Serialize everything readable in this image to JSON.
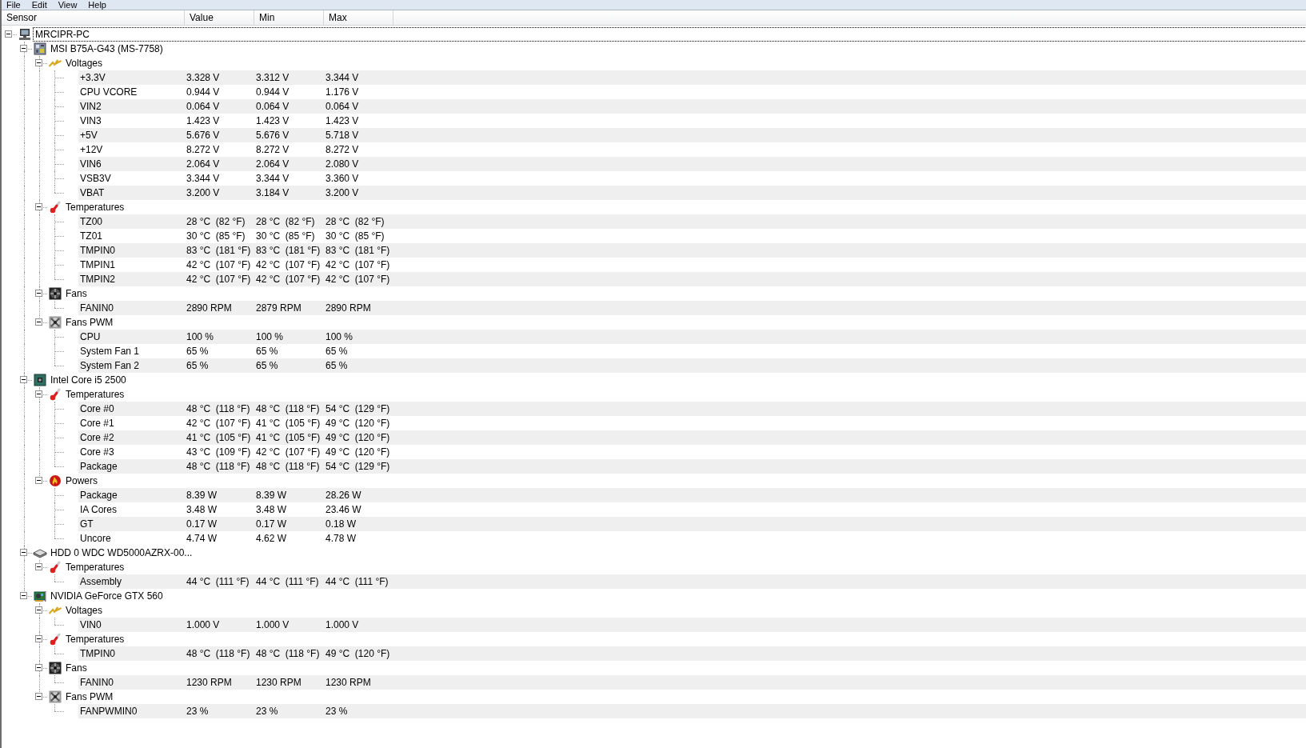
{
  "menu": [
    "File",
    "Edit",
    "View",
    "Help"
  ],
  "columns": [
    "Sensor",
    "Value",
    "Min",
    "Max"
  ],
  "tree": [
    {
      "label": "MRCIPR-PC",
      "kind": "computer",
      "expanded": true,
      "focused": true,
      "children": [
        {
          "label": "MSI B75A-G43 (MS-7758)",
          "kind": "motherboard",
          "expanded": true,
          "children": [
            {
              "label": "Voltages",
              "kind": "voltage",
              "expanded": true,
              "children": [
                {
                  "label": "+3.3V",
                  "value": "3.328 V",
                  "min": "3.312 V",
                  "max": "3.344 V"
                },
                {
                  "label": "CPU VCORE",
                  "value": "0.944 V",
                  "min": "0.944 V",
                  "max": "1.176 V"
                },
                {
                  "label": "VIN2",
                  "value": "0.064 V",
                  "min": "0.064 V",
                  "max": "0.064 V"
                },
                {
                  "label": "VIN3",
                  "value": "1.423 V",
                  "min": "1.423 V",
                  "max": "1.423 V"
                },
                {
                  "label": "+5V",
                  "value": "5.676 V",
                  "min": "5.676 V",
                  "max": "5.718 V"
                },
                {
                  "label": "+12V",
                  "value": "8.272 V",
                  "min": "8.272 V",
                  "max": "8.272 V"
                },
                {
                  "label": "VIN6",
                  "value": "2.064 V",
                  "min": "2.064 V",
                  "max": "2.080 V"
                },
                {
                  "label": "VSB3V",
                  "value": "3.344 V",
                  "min": "3.344 V",
                  "max": "3.360 V"
                },
                {
                  "label": "VBAT",
                  "value": "3.200 V",
                  "min": "3.184 V",
                  "max": "3.200 V"
                }
              ]
            },
            {
              "label": "Temperatures",
              "kind": "temperature",
              "expanded": true,
              "children": [
                {
                  "label": "TZ00",
                  "value": "28 °C  (82 °F)",
                  "min": "28 °C  (82 °F)",
                  "max": "28 °C  (82 °F)"
                },
                {
                  "label": "TZ01",
                  "value": "30 °C  (85 °F)",
                  "min": "30 °C  (85 °F)",
                  "max": "30 °C  (85 °F)"
                },
                {
                  "label": "TMPIN0",
                  "value": "83 °C  (181 °F)",
                  "min": "83 °C  (181 °F)",
                  "max": "83 °C  (181 °F)"
                },
                {
                  "label": "TMPIN1",
                  "value": "42 °C  (107 °F)",
                  "min": "42 °C  (107 °F)",
                  "max": "42 °C  (107 °F)"
                },
                {
                  "label": "TMPIN2",
                  "value": "42 °C  (107 °F)",
                  "min": "42 °C  (107 °F)",
                  "max": "42 °C  (107 °F)"
                }
              ]
            },
            {
              "label": "Fans",
              "kind": "fan",
              "expanded": true,
              "children": [
                {
                  "label": "FANIN0",
                  "value": "2890 RPM",
                  "min": "2879 RPM",
                  "max": "2890 RPM"
                }
              ]
            },
            {
              "label": "Fans PWM",
              "kind": "fan-pwm",
              "expanded": true,
              "children": [
                {
                  "label": "CPU",
                  "value": "100 %",
                  "min": "100 %",
                  "max": "100 %"
                },
                {
                  "label": "System Fan 1",
                  "value": "65 %",
                  "min": "65 %",
                  "max": "65 %"
                },
                {
                  "label": "System Fan 2",
                  "value": "65 %",
                  "min": "65 %",
                  "max": "65 %"
                }
              ]
            }
          ]
        },
        {
          "label": "Intel Core i5 2500",
          "kind": "cpu",
          "expanded": true,
          "children": [
            {
              "label": "Temperatures",
              "kind": "temperature",
              "expanded": true,
              "children": [
                {
                  "label": "Core #0",
                  "value": "48 °C  (118 °F)",
                  "min": "48 °C  (118 °F)",
                  "max": "54 °C  (129 °F)"
                },
                {
                  "label": "Core #1",
                  "value": "42 °C  (107 °F)",
                  "min": "41 °C  (105 °F)",
                  "max": "49 °C  (120 °F)"
                },
                {
                  "label": "Core #2",
                  "value": "41 °C  (105 °F)",
                  "min": "41 °C  (105 °F)",
                  "max": "49 °C  (120 °F)"
                },
                {
                  "label": "Core #3",
                  "value": "43 °C  (109 °F)",
                  "min": "42 °C  (107 °F)",
                  "max": "49 °C  (120 °F)"
                },
                {
                  "label": "Package",
                  "value": "48 °C  (118 °F)",
                  "min": "48 °C  (118 °F)",
                  "max": "54 °C  (129 °F)"
                }
              ]
            },
            {
              "label": "Powers",
              "kind": "power",
              "expanded": true,
              "children": [
                {
                  "label": "Package",
                  "value": "8.39 W",
                  "min": "8.39 W",
                  "max": "28.26 W"
                },
                {
                  "label": "IA Cores",
                  "value": "3.48 W",
                  "min": "3.48 W",
                  "max": "23.46 W"
                },
                {
                  "label": "GT",
                  "value": "0.17 W",
                  "min": "0.17 W",
                  "max": "0.18 W"
                },
                {
                  "label": "Uncore",
                  "value": "4.74 W",
                  "min": "4.62 W",
                  "max": "4.78 W"
                }
              ]
            }
          ]
        },
        {
          "label": "HDD 0 WDC WD5000AZRX-00...",
          "kind": "hdd",
          "expanded": true,
          "children": [
            {
              "label": "Temperatures",
              "kind": "temperature",
              "expanded": true,
              "children": [
                {
                  "label": "Assembly",
                  "value": "44 °C  (111 °F)",
                  "min": "44 °C  (111 °F)",
                  "max": "44 °C  (111 °F)"
                }
              ]
            }
          ]
        },
        {
          "label": "NVIDIA GeForce GTX 560",
          "kind": "gpu",
          "expanded": true,
          "children": [
            {
              "label": "Voltages",
              "kind": "voltage",
              "expanded": true,
              "children": [
                {
                  "label": "VIN0",
                  "value": "1.000 V",
                  "min": "1.000 V",
                  "max": "1.000 V"
                }
              ]
            },
            {
              "label": "Temperatures",
              "kind": "temperature",
              "expanded": true,
              "children": [
                {
                  "label": "TMPIN0",
                  "value": "48 °C  (118 °F)",
                  "min": "48 °C  (118 °F)",
                  "max": "49 °C  (120 °F)"
                }
              ]
            },
            {
              "label": "Fans",
              "kind": "fan",
              "expanded": true,
              "children": [
                {
                  "label": "FANIN0",
                  "value": "1230 RPM",
                  "min": "1230 RPM",
                  "max": "1230 RPM"
                }
              ]
            },
            {
              "label": "Fans PWM",
              "kind": "fan-pwm",
              "expanded": true,
              "children": [
                {
                  "label": "FANPWMIN0",
                  "value": "23 %",
                  "min": "23 %",
                  "max": "23 %"
                }
              ]
            }
          ]
        }
      ]
    }
  ]
}
